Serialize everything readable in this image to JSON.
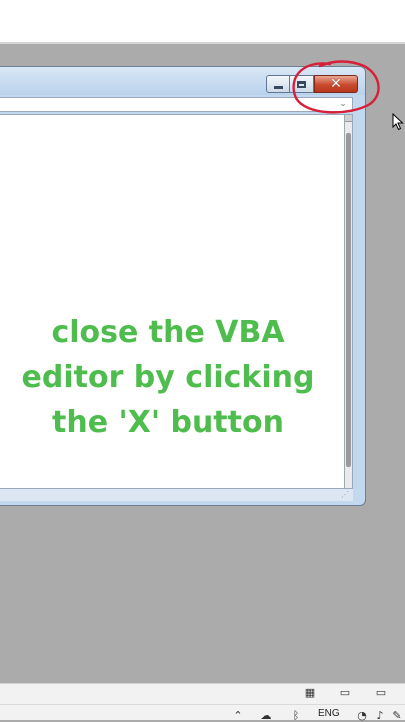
{
  "window": {
    "minimize_label": "",
    "maximize_label": "",
    "close_glyph": "✕"
  },
  "combo": {
    "arrow": "⌄"
  },
  "caption": {
    "line1": "close the VBA",
    "line2": "editor by clicking",
    "line3": "the 'X' button"
  },
  "taskbar": {
    "language": "ENG",
    "icons": [
      "view-icon",
      "keyboard-icon",
      "monitor-icon",
      "up-arrow-icon",
      "cloud-icon",
      "bluetooth-icon",
      "wifi-icon",
      "volume-icon",
      "pen-icon"
    ]
  },
  "colors": {
    "caption": "#4ebd4e",
    "annotation_circle": "#d6203a",
    "close_button": "#c94a2e",
    "desktop": "#ababab"
  }
}
